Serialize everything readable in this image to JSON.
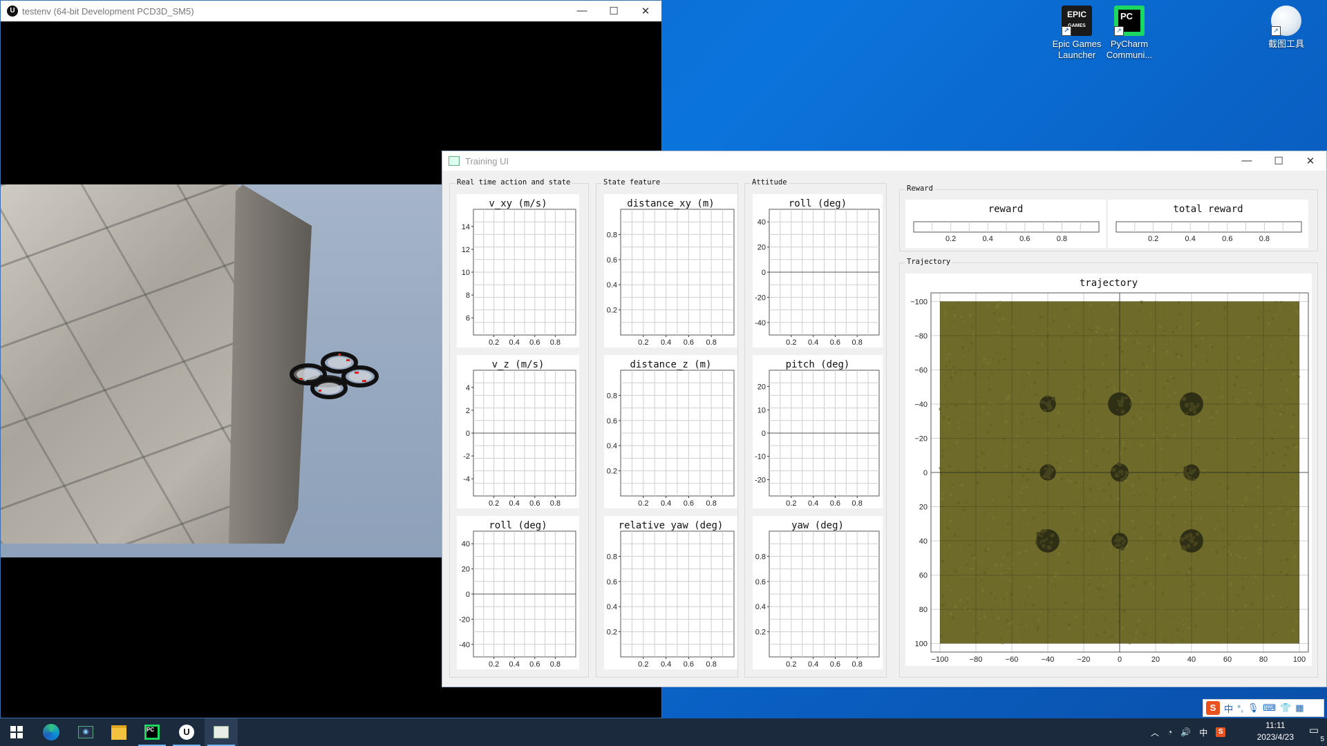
{
  "desktop": {
    "icons": [
      {
        "label_line1": "Epic Games",
        "label_line2": "Launcher",
        "logo_text": "EPIC\nGAMES"
      },
      {
        "label_line1": "PyCharm",
        "label_line2": "Communi...",
        "logo_text": "PC"
      },
      {
        "label_line1": "截图工具",
        "label_line2": ""
      }
    ]
  },
  "ue_window": {
    "title": "testenv (64-bit Development PCD3D_SM5)",
    "app_icon": "unreal-icon"
  },
  "window_controls": {
    "minimize": "—",
    "maximize": "☐",
    "close": "✕"
  },
  "training_ui": {
    "title": "Training UI",
    "groups": {
      "realtime": "Real time action and state",
      "state_feature": "State feature",
      "attitude": "Attitude",
      "reward": "Reward",
      "trajectory": "Trajectory"
    },
    "small_plots": [
      {
        "id": "p_vxy",
        "title": "v_xy (m/s)",
        "yticks": [
          "14",
          "12",
          "10",
          "8",
          "6"
        ],
        "ytickvals": [
          14,
          12,
          10,
          8,
          6
        ],
        "ymin": 4.5,
        "ymax": 15.5,
        "zero": false
      },
      {
        "id": "p_dxy",
        "title": "distance_xy (m)",
        "yticks": [
          "0.8",
          "0.6",
          "0.4",
          "0.2"
        ],
        "ytickvals": [
          0.8,
          0.6,
          0.4,
          0.2
        ],
        "ymin": 0,
        "ymax": 1,
        "zero": false
      },
      {
        "id": "p_roll_att",
        "title": "roll (deg)",
        "yticks": [
          "40",
          "20",
          "0",
          "-20",
          "-40"
        ],
        "ytickvals": [
          40,
          20,
          0,
          -20,
          -40
        ],
        "ymin": -50,
        "ymax": 50,
        "zero": true
      },
      {
        "id": "p_vz",
        "title": "v_z (m/s)",
        "yticks": [
          "4",
          "2",
          "0",
          "-2",
          "-4"
        ],
        "ytickvals": [
          4,
          2,
          0,
          -2,
          -4
        ],
        "ymin": -5.5,
        "ymax": 5.5,
        "zero": true
      },
      {
        "id": "p_dz",
        "title": "distance_z (m)",
        "yticks": [
          "0.8",
          "0.6",
          "0.4",
          "0.2"
        ],
        "ytickvals": [
          0.8,
          0.6,
          0.4,
          0.2
        ],
        "ymin": 0,
        "ymax": 1,
        "zero": false
      },
      {
        "id": "p_pitch",
        "title": "pitch (deg)",
        "yticks": [
          "20",
          "10",
          "0",
          "-10",
          "-20"
        ],
        "ytickvals": [
          20,
          10,
          0,
          -10,
          -20
        ],
        "ymin": -27,
        "ymax": 27,
        "zero": true
      },
      {
        "id": "p_roll_rt",
        "title": "roll (deg)",
        "yticks": [
          "40",
          "20",
          "0",
          "-20",
          "-40"
        ],
        "ytickvals": [
          40,
          20,
          0,
          -20,
          -40
        ],
        "ymin": -50,
        "ymax": 50,
        "zero": true
      },
      {
        "id": "p_ryaw",
        "title": "relative yaw (deg)",
        "yticks": [
          "0.8",
          "0.6",
          "0.4",
          "0.2"
        ],
        "ytickvals": [
          0.8,
          0.6,
          0.4,
          0.2
        ],
        "ymin": 0,
        "ymax": 1,
        "zero": false
      },
      {
        "id": "p_yaw",
        "title": "yaw (deg)",
        "yticks": [
          "0.8",
          "0.6",
          "0.4",
          "0.2"
        ],
        "ytickvals": [
          0.8,
          0.6,
          0.4,
          0.2
        ],
        "ymin": 0,
        "ymax": 1,
        "zero": false
      }
    ],
    "x_ticks": [
      "0.2",
      "0.4",
      "0.6",
      "0.8"
    ],
    "x_tickvals": [
      0.2,
      0.4,
      0.6,
      0.8
    ],
    "reward_plots": [
      {
        "id": "p_reward",
        "title": "reward"
      },
      {
        "id": "p_total",
        "title": "total reward"
      }
    ],
    "trajectory": {
      "title": "trajectory",
      "xticks": [
        "−100",
        "−80",
        "−60",
        "−40",
        "−20",
        "0",
        "20",
        "40",
        "60",
        "80",
        "100"
      ],
      "yticks": [
        "−100",
        "−80",
        "−60",
        "−40",
        "−20",
        "0",
        "20",
        "40",
        "60",
        "80",
        "100"
      ],
      "tickvals": [
        -100,
        -80,
        -60,
        -40,
        -20,
        0,
        20,
        40,
        60,
        80,
        100
      ],
      "range": [
        -105,
        105
      ],
      "field_color": "#6e6b2a",
      "obstacles": [
        {
          "x": -40,
          "y": -40,
          "r": 4.5
        },
        {
          "x": 0,
          "y": -40,
          "r": 6.5
        },
        {
          "x": 40,
          "y": -40,
          "r": 6.5
        },
        {
          "x": -40,
          "y": 0,
          "r": 4.5
        },
        {
          "x": 0,
          "y": 0,
          "r": 5
        },
        {
          "x": 40,
          "y": 0,
          "r": 4.5
        },
        {
          "x": -40,
          "y": 40,
          "r": 6.5
        },
        {
          "x": 0,
          "y": 40,
          "r": 4.5
        },
        {
          "x": 40,
          "y": 40,
          "r": 6.5
        }
      ]
    }
  },
  "taskbar": {
    "clock_time": "11:11",
    "clock_date": "2023/4/23",
    "ime_lang": "中",
    "notification_count": "5",
    "tray_text": "中"
  }
}
